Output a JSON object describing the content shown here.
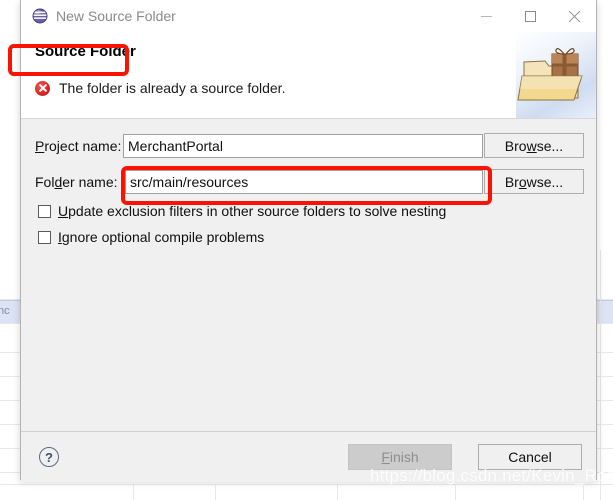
{
  "window": {
    "title": "New Source Folder",
    "app_icon": "eclipse-sphere-icon",
    "controls": {
      "minimize": "minimize-icon",
      "maximize": "maximize-icon",
      "close": "close-icon"
    }
  },
  "header": {
    "title": "Source Folder",
    "message": "The folder is already a source folder.",
    "message_severity": "error",
    "message_icon": "error-circle-x-icon",
    "banner_icon": "folder-with-gift-icon"
  },
  "form": {
    "project": {
      "label_prefix": "",
      "label_mnemonic": "P",
      "label_suffix": "roject name:",
      "value": "MerchantPortal",
      "placeholder": "",
      "browse_prefix": "Bro",
      "browse_mnemonic": "w",
      "browse_suffix": "se..."
    },
    "folder": {
      "label_prefix": "Fol",
      "label_mnemonic": "d",
      "label_suffix": "er name:",
      "value": "src/main/resources",
      "placeholder": "",
      "browse_prefix": "Br",
      "browse_mnemonic": "o",
      "browse_suffix": "wse..."
    },
    "checkboxes": [
      {
        "prefix": "",
        "mnemonic": "U",
        "suffix": "pdate exclusion filters in other source folders to solve nesting",
        "checked": false
      },
      {
        "prefix": "",
        "mnemonic": "I",
        "suffix": "gnore optional compile problems",
        "checked": false
      }
    ]
  },
  "footer": {
    "help_glyph": "?",
    "finish": {
      "prefix": "",
      "mnemonic": "F",
      "suffix": "inish",
      "enabled": false
    },
    "cancel": {
      "label": "Cancel",
      "enabled": true
    }
  },
  "annotations": {
    "color": "#fb1200",
    "boxes": [
      "source-folder-title",
      "folder-name-input"
    ]
  },
  "watermark": {
    "text": "https://blog.csdn.net/Kevin_Rose"
  },
  "background": {
    "text_fragment": "nc"
  }
}
